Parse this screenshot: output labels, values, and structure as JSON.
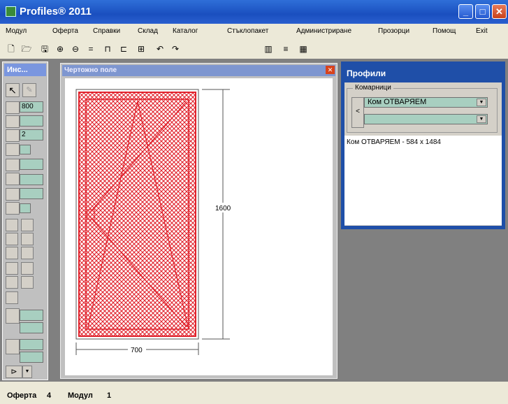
{
  "window": {
    "title": "Profiles® 2011",
    "min": "_",
    "max": "□",
    "close": "✕"
  },
  "menu": [
    "Модул",
    "Оферта",
    "Справки",
    "Склад",
    "Каталог",
    "Стъклопакет",
    "Администриране",
    "Прозорци",
    "Помощ",
    "Exit"
  ],
  "toolbar": {
    "icons": [
      "new-icon",
      "open-icon",
      "save-icon",
      "zoom-in-icon",
      "zoom-out-icon",
      "equal-icon",
      "profile-a-icon",
      "profile-b-icon",
      "sash-icon",
      "undo-icon",
      "redo-icon",
      "view-grid-icon",
      "lines-icon",
      "table-icon"
    ],
    "glyphs": [
      "🗋",
      "🗁",
      "🖫",
      "⊕",
      "⊖",
      "=",
      "⊓",
      "⊏",
      "⊞",
      "↶",
      "↷",
      "▥",
      "≡",
      "▦"
    ]
  },
  "inspector": {
    "title": "Инс...",
    "width_value": "800",
    "count_value": "2"
  },
  "drawing": {
    "title": "Чертожно поле",
    "close": "✕",
    "height_label": "1600",
    "width_label": "700"
  },
  "profiles": {
    "title": "Профили",
    "group_label": "Комарници",
    "combo1_value": "Ком ОТВАРЯЕМ",
    "combo2_value": "",
    "list_items": [
      "Ком ОТВАРЯЕМ - 584 x 1484"
    ]
  },
  "status": {
    "offer_label": "Оферта",
    "offer_no": "4",
    "module_label": "Модул",
    "module_no": "1"
  },
  "colors": {
    "title_bar": "#2a5fcf",
    "hatch": "#e0202a",
    "field": "#a8cfc0"
  }
}
